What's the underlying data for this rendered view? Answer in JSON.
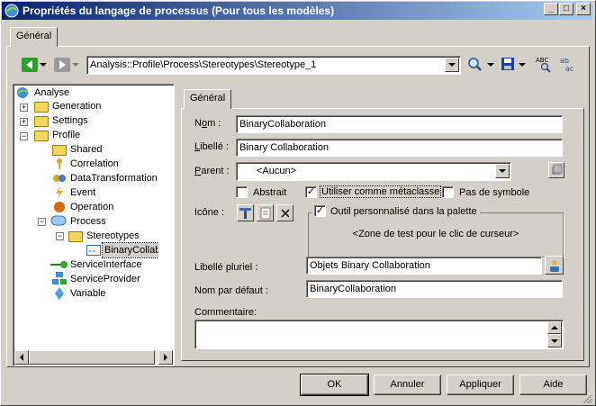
{
  "window": {
    "title": "Propriétés du langage de processus  (Pour tous les modèles)",
    "minimize_glyph": "_",
    "maximize_glyph": "□",
    "close_glyph": "×"
  },
  "outer_tab": "Général",
  "toolbar": {
    "path_value": "Analysis::Profile\\Process\\Stereotypes\\Stereotype_1"
  },
  "tree": {
    "items": [
      {
        "label": "Analyse"
      },
      {
        "label": "Generation"
      },
      {
        "label": "Settings"
      },
      {
        "label": "Profile"
      },
      {
        "label": "Shared"
      },
      {
        "label": "Correlation"
      },
      {
        "label": "DataTransformation"
      },
      {
        "label": "Event"
      },
      {
        "label": "Operation"
      },
      {
        "label": "Process"
      },
      {
        "label": "Stereotypes"
      },
      {
        "label": "BinaryCollaboration"
      },
      {
        "label": "ServiceInterface"
      },
      {
        "label": "ServiceProvider"
      },
      {
        "label": "Variable"
      }
    ]
  },
  "inner_tab": "Général",
  "form": {
    "nom_label_pre": "N",
    "nom_label_u": "o",
    "nom_label_post": "m :",
    "nom_value": "BinaryCollaboration",
    "libelle_label_pre": "",
    "libelle_label_u": "L",
    "libelle_label_post": "ibellé :",
    "libelle_value": "Binary Collaboration",
    "parent_label_pre": "",
    "parent_label_u": "P",
    "parent_label_post": "arent :",
    "parent_value": "<Aucun>",
    "abstrait_label": "Abstrait",
    "abstrait_checked": false,
    "metaclasse_label": "Utiliser comme métaclasse",
    "metaclasse_checked": true,
    "pas_symbole_label": "Pas de symbole",
    "pas_symbole_checked": false,
    "icone_label": "Icône :",
    "outil_label": "Outil personnalisé dans la palette",
    "outil_checked": true,
    "zone_test": "<Zone de test pour le clic de curseur>",
    "pluriel_label": "Libellé pluriel :",
    "pluriel_value": "Objets Binary Collaboration",
    "defaut_label": "Nom par défaut :",
    "defaut_value": "BinaryCollaboration",
    "commentaire_label": "Commentaire:",
    "commentaire_value": ""
  },
  "buttons": {
    "ok": "OK",
    "annuler": "Annuler",
    "appliquer": "Appliquer",
    "aide": "Aide"
  },
  "icons": {
    "back": "back-arrow-icon",
    "forward": "forward-arrow-icon",
    "find": "find-icon",
    "save": "save-icon",
    "spell": "spell-check-icon",
    "sort": "sort-az-icon"
  }
}
